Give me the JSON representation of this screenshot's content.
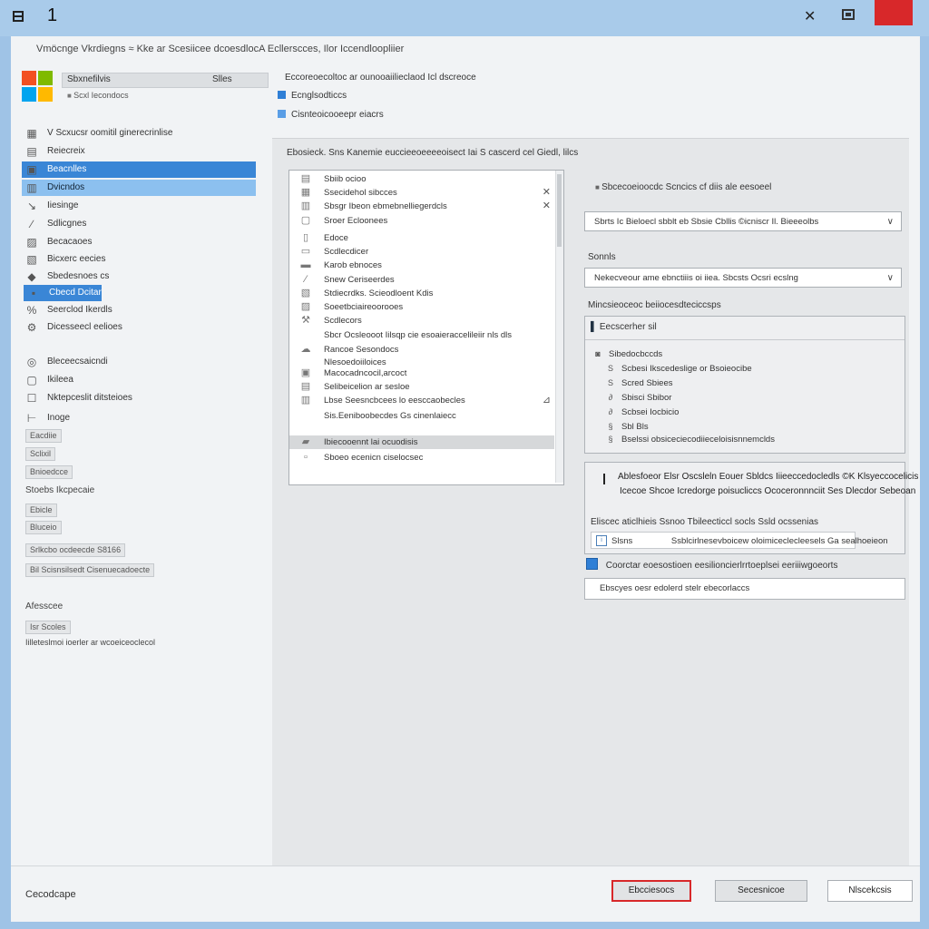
{
  "titlebar": {
    "number": "1"
  },
  "header_line": "Vmöcnge Vkrdiegns ≈ Kke ar Scesiicee dcoesdlocA Ecllerscces, Ilor Iccendloopliier",
  "account": {
    "name": "Sbxnefilvis",
    "side_text": "Slles",
    "sub": "Scxl Iecondocs"
  },
  "sidebar": {
    "items": [
      {
        "label": "V Scxucsr oomitil ginerecrinlise",
        "icon": "monitor-icon",
        "glyph": "▦"
      },
      {
        "label": "Reiecreix",
        "icon": "calendar-icon",
        "glyph": "▤"
      },
      {
        "label": "Beacnlles",
        "icon": "settings-icon",
        "glyph": "▣"
      },
      {
        "label": "Dvicndos",
        "icon": "document-icon",
        "glyph": "▥"
      },
      {
        "label": "Iiesinge",
        "icon": "arrow-icon",
        "glyph": "↘"
      },
      {
        "label": "Sdlicgnes",
        "icon": "pen-icon",
        "glyph": "∕"
      },
      {
        "label": "Becacaoes",
        "icon": "image-icon",
        "glyph": "▨"
      },
      {
        "label": "Bicxerc eecies",
        "icon": "photo-icon",
        "glyph": "▧"
      },
      {
        "label": "Sbedesnoes cs",
        "icon": "folder-icon",
        "glyph": "◆"
      },
      {
        "label": "Cbecd Dcitar",
        "icon": "cloud-icon",
        "glyph": "▪"
      },
      {
        "label": "Seerclod Ikerdls",
        "icon": "network-icon",
        "glyph": "%"
      },
      {
        "label": "Dicesseecl eelioes",
        "icon": "tools-icon",
        "glyph": "⚙"
      },
      {
        "label": "Bleceecsaicndi",
        "icon": "globe-icon",
        "glyph": "◎"
      },
      {
        "label": "Ikileea",
        "icon": "page-icon",
        "glyph": "▢"
      },
      {
        "label": "Nktepceslit ditsteioes",
        "icon": "checkbox-icon",
        "glyph": "☐"
      },
      {
        "label": "Inoge",
        "icon": "tag-icon",
        "glyph": "⊢"
      }
    ],
    "mini_buttons": [
      "Eacdiie",
      "Sclixil",
      "Bnioedcce"
    ],
    "section_label": "Stoebs Ikcpecaie",
    "mini_buttons_2": [
      "Ebicle",
      "Bluceio"
    ],
    "wide_buttons": [
      "Srlkcbo ocdeecde S8166",
      "Bil Scisnsilsedt Cisenuecadoecte"
    ],
    "section2_label": "Afesscee",
    "small_box": "Isr Scoles",
    "bottom_text": "Iilleteslmoi ioerler ar wcoeiceoclecol"
  },
  "center": {
    "heading": "Eccoreoecoltoc ar ounooaiilieclaod Icl dscreoce",
    "link1": "Ecnglsodticcs",
    "link2": "Cisnteoicooeepr eiacrs",
    "list_title": "Ebosieck. Sns Kanemie euccieeoeeeeoisect Iai S cascerd cel Giedl, lilcs",
    "list_items": [
      {
        "label": "Sbiib ocioo",
        "icon": "server-icon",
        "glyph": "▤"
      },
      {
        "label": "Ssecidehol sibcces",
        "icon": "disk-icon",
        "glyph": "▦",
        "x": "✕"
      },
      {
        "label": "Sbsgr Ibeon ebmebnelliegerdcls",
        "icon": "keyboard-icon",
        "glyph": "▥",
        "x": "✕"
      },
      {
        "label": "Sroer Ecloonees",
        "icon": "monitor-icon",
        "glyph": "▢"
      },
      {
        "label": "Edoce",
        "icon": "cable-icon",
        "glyph": "▯"
      },
      {
        "label": "Scdlecdicer",
        "icon": "printer-icon",
        "glyph": "▭"
      },
      {
        "label": "Karob ebnoces",
        "icon": "drive-icon",
        "glyph": "▬"
      },
      {
        "label": "Snew Ceriseerdes",
        "icon": "pen-icon",
        "glyph": "∕"
      },
      {
        "label": "Stdiecrdks. Scieodloent Kdis",
        "icon": "image-icon",
        "glyph": "▧"
      },
      {
        "label": "Soeetbciaireoorooes",
        "icon": "chip-icon",
        "glyph": "▨"
      },
      {
        "label": "Scdlecors",
        "icon": "tool-icon",
        "glyph": "⚒"
      },
      {
        "label": "Sbcr Ocsleooot Iilsqp cie esoaieraccelileiir nls dls",
        "icon": "blank-icon",
        "glyph": ""
      },
      {
        "label": "Rancoe Sesondocs",
        "icon": "cloud-icon",
        "glyph": "☁"
      },
      {
        "label": "Nlesoedoiiloices",
        "icon": "blank-icon",
        "glyph": ""
      },
      {
        "label": "Macocadncocil,arcoct",
        "icon": "board-icon",
        "glyph": "▣"
      },
      {
        "label": "Selibeicelion ar sesloe",
        "icon": "screen-icon",
        "glyph": "▤"
      },
      {
        "label": "Lbse Seesncbcees lo eesccaobecles",
        "icon": "database-icon",
        "glyph": "▥",
        "x": "⊿"
      },
      {
        "label": "Sis.Eeniboobecdes Gs cinenlaiecc",
        "icon": "blank-icon",
        "glyph": ""
      },
      {
        "label": "Ibiecooennt lai ocuodisis",
        "icon": "folder-icon",
        "glyph": "▰",
        "highlight": true
      },
      {
        "label": "Sboeo ecenicn ciselocsec",
        "icon": "page-icon",
        "glyph": "▫"
      }
    ]
  },
  "right": {
    "title": "Sbcecoeioocdc Scncics cf diis ale eesoeel",
    "select1": "Sbrts Ic Bieloecl sbblt eb Sbsie Cbllis ©icniscr Il. Bieeeolbs",
    "label2": "Sonnls",
    "select2": "Nekecveour ame ebnctiiis oi iiea. Sbcsts Ocsri ecslng",
    "label3": "Mincsieoceoc beiiocesdteciccsps",
    "group1": {
      "title": "Eecscerher sil",
      "items": [
        {
          "label": "Sibedocbccds",
          "glyph": "◙"
        },
        {
          "label": "Scbesi Ikscedeslige or Bsoieocibe",
          "glyph": "S"
        },
        {
          "label": "Scred Sbiees",
          "glyph": "S"
        },
        {
          "label": "Sbisci Sbibor",
          "glyph": "∂"
        },
        {
          "label": "Scbsei Iocbicio",
          "glyph": "∂"
        },
        {
          "label": "Sbl Bls",
          "glyph": "§"
        },
        {
          "label": "Bselssi obsiceciecodiieceloisisnnemclds",
          "glyph": "§"
        }
      ]
    },
    "group2": {
      "line1": "Ablesfoeor Elsr Oscsleln Eouer Sbldcs Iiieeccedocledls ©K Klsyeccocelicis",
      "line2": "Icecoe Shcoe Icredorge poisucliccs Ococeronnnciit Ses Dlecdor Sebeoan",
      "sub": "Eliscec aticlhieis Ssnoo Tbileecticcl socls Ssld ocssenias",
      "row_left": "Slsns",
      "row_text": "Ssblcirlnesevboicew oloimiceclecleesels Ga sealhoeieon"
    },
    "checkbox_label": "Coorctar eoesostioen eesilioncierlrrtoeplsei eeriiiwgoeorts",
    "textbox": "Ebscyes oesr edolerd stelr ebecorlaccs"
  },
  "footer": {
    "status": "Cecodcape",
    "btn_primary": "Ebcciesocs",
    "btn_secondary": "Secesnicoe",
    "btn_third": "Nlscekcsis"
  }
}
